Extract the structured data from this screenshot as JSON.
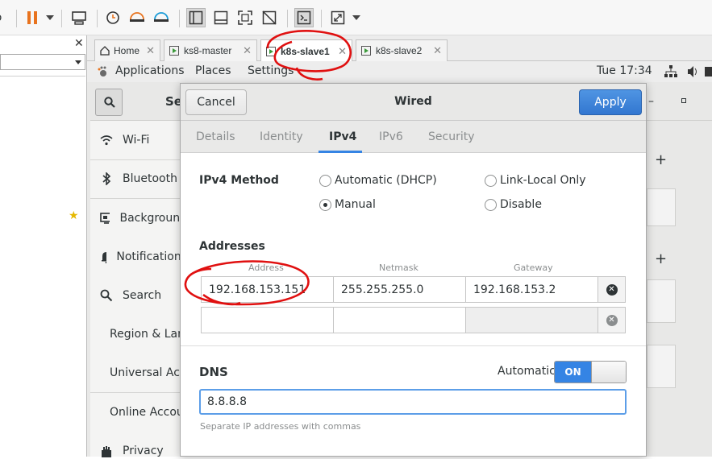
{
  "tabs": [
    {
      "label": "Home"
    },
    {
      "label": "ks8-master"
    },
    {
      "label": "k8s-slave1"
    },
    {
      "label": "k8s-slave2"
    }
  ],
  "topbar": {
    "applications": "Applications",
    "places": "Places",
    "settings": "Settings",
    "clock": "Tue 17:34"
  },
  "settings_header": {
    "title_partial": "Se"
  },
  "sidebar": {
    "items": [
      {
        "label": "Wi-Fi",
        "icon": "wifi-icon"
      },
      {
        "label": "Bluetooth",
        "icon": "bluetooth-icon"
      },
      {
        "label": "Background",
        "icon": "background-icon"
      },
      {
        "label": "Notifications",
        "icon": "bell-icon"
      },
      {
        "label": "Search",
        "icon": "search-icon"
      },
      {
        "label": "Region & Language",
        "icon": "region-icon"
      },
      {
        "label": "Universal Access",
        "icon": "accessibility-icon"
      },
      {
        "label": "Online Accounts",
        "icon": "online-accounts-icon"
      },
      {
        "label": "Privacy",
        "icon": "privacy-icon"
      }
    ]
  },
  "dialog": {
    "title": "Wired",
    "cancel_label": "Cancel",
    "apply_label": "Apply",
    "tabs": [
      "Details",
      "Identity",
      "IPv4",
      "IPv6",
      "Security"
    ],
    "active_tab": "IPv4",
    "method_label": "IPv4 Method",
    "methods": [
      {
        "label": "Automatic (DHCP)",
        "selected": false
      },
      {
        "label": "Link-Local Only",
        "selected": false
      },
      {
        "label": "Manual",
        "selected": true
      },
      {
        "label": "Disable",
        "selected": false
      }
    ],
    "addresses_label": "Addresses",
    "columns": {
      "address": "Address",
      "netmask": "Netmask",
      "gateway": "Gateway"
    },
    "rows": [
      {
        "address": "192.168.153.151",
        "netmask": "255.255.255.0",
        "gateway": "192.168.153.2"
      },
      {
        "address": "",
        "netmask": "",
        "gateway": ""
      }
    ],
    "dns_label": "DNS",
    "automatic_label": "Automatic",
    "toggle_label": "ON",
    "dns_value": "8.8.8.8",
    "dns_hint": "Separate IP addresses with commas"
  },
  "colors": {
    "accent": "#3584e4",
    "annotation": "#e01010"
  }
}
